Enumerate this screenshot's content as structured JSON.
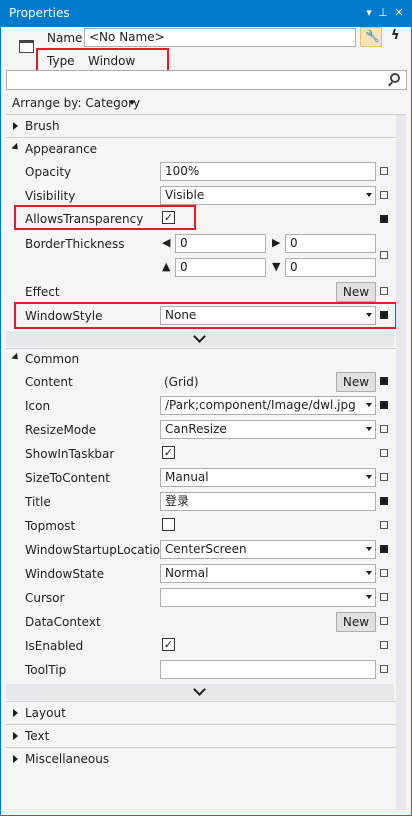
{
  "window": {
    "title": "Properties"
  },
  "header": {
    "name_label": "Name",
    "name_value": "<No Name>",
    "type_label": "Type",
    "type_value": "Window"
  },
  "toolbar": {
    "arrange_label": "Arrange by: Category"
  },
  "categories": {
    "brush": "Brush",
    "appearance": "Appearance",
    "common": "Common",
    "layout": "Layout",
    "text": "Text",
    "misc": "Miscellaneous"
  },
  "appearance": {
    "opacity_label": "Opacity",
    "opacity_value": "100%",
    "visibility_label": "Visibility",
    "visibility_value": "Visible",
    "allows_label": "AllowsTransparency",
    "allows_checked": "✓",
    "border_label": "BorderThickness",
    "border_left": "0",
    "border_right": "0",
    "border_top": "0",
    "border_bottom": "0",
    "effect_label": "Effect",
    "new_label": "New",
    "winstyle_label": "WindowStyle",
    "winstyle_value": "None"
  },
  "common": {
    "content_label": "Content",
    "content_value": "(Grid)",
    "new_label": "New",
    "icon_label": "Icon",
    "icon_value": "/Park;component/Image/dwl.jpg",
    "resize_label": "ResizeMode",
    "resize_value": "CanResize",
    "taskbar_label": "ShowInTaskbar",
    "taskbar_checked": "✓",
    "sizetc_label": "SizeToContent",
    "sizetc_value": "Manual",
    "title_label": "Title",
    "title_value": "登录",
    "topmost_label": "Topmost",
    "startup_label": "WindowStartupLocation",
    "startup_value": "CenterScreen",
    "state_label": "WindowState",
    "state_value": "Normal",
    "cursor_label": "Cursor",
    "cursor_value": "",
    "datactx_label": "DataContext",
    "enabled_label": "IsEnabled",
    "enabled_checked": "✓",
    "tooltip_label": "ToolTip",
    "tooltip_value": ""
  }
}
